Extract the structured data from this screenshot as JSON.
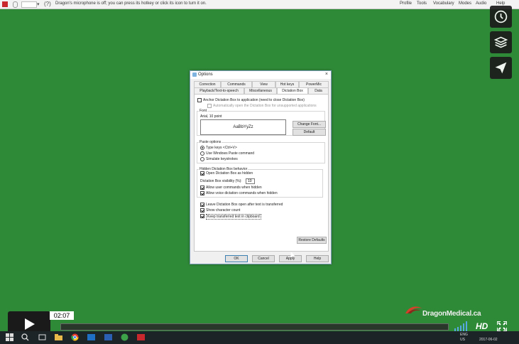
{
  "dragon_bar": {
    "message": "Dragon's microphone is off; you can press its hotkey or click its icon to turn it on.",
    "menus": [
      "Profile",
      "Tools",
      "Vocabulary",
      "Modes",
      "Audio",
      "Help"
    ],
    "help_glyph": "(?)",
    "field_arrow": "▾"
  },
  "dialog": {
    "title": "Options",
    "close_glyph": "×",
    "tabs_top": [
      "Correction",
      "Commands",
      "View",
      "Hot keys",
      "PowerMic"
    ],
    "tabs_bottom": [
      "Playback/Text-to-speech",
      "Miscellaneous",
      "Dictation Box",
      "Data"
    ],
    "anchor_label": "Anchor Dictation Box to application (need to close Dictation Box)",
    "auto_open_label": "Automatically open the Dictation Box for unsupported applications",
    "font_group": "Font",
    "font_value": "Arial, 10 point",
    "preview_text": "AaBbYyZz",
    "change_font": "Change Font...",
    "default": "Default",
    "paste_group": "Paste options",
    "paste_options": [
      "Type keys <Ctrl+V>",
      "Use Windows Paste command",
      "Simulate keystrokes"
    ],
    "hidden_group": "Hidden Dictation Box behavior",
    "open_hidden": "Open Dictation Box as hidden",
    "visibility_label": "Dictation Box visibility (%):",
    "visibility_value": "10",
    "allow_user": "Allow user commands when hidden",
    "allow_voice": "Allow voice dictation commands when hidden",
    "leave_open": "Leave Dictation Box open after text is transferred",
    "show_count": "Show character count",
    "keep_text": "Keep transferred text in clipboard",
    "restore": "Restore Defaults",
    "ok": "OK",
    "cancel": "Cancel",
    "apply": "Apply",
    "help": "Help"
  },
  "player": {
    "time": "02:07",
    "progress": 0.0,
    "hd": "HD",
    "logo": "DragonMedical.ca"
  },
  "taskbar": {
    "tray_lang": "ENG",
    "tray_region": "US",
    "tray_date": "2017-06-02"
  },
  "colors": {
    "desktop": "#2f8a38",
    "dialog_accent": "#3c7fb1",
    "dragon_red": "#c9282d"
  }
}
